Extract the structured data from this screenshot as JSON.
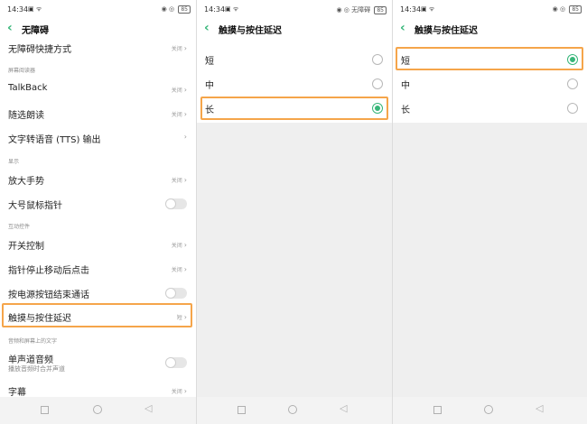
{
  "status": {
    "time": "14:34",
    "icons": "▣ ᯤ",
    "right_icons": "◉ ◎",
    "battery": "85",
    "right_label_p2": "无障碍"
  },
  "panel1": {
    "title": "无障碍",
    "rows": {
      "shortcut": {
        "label": "无障碍快捷方式",
        "value": "关闭"
      },
      "sec_screen_reader": "屏幕阅读器",
      "talkback": {
        "label": "TalkBack",
        "value": "关闭"
      },
      "select_speak": {
        "label": "随选朗读",
        "value": "关闭"
      },
      "tts": {
        "label": "文字转语音 (TTS) 输出"
      },
      "sec_display": "显示",
      "magnify": {
        "label": "放大手势",
        "value": "关闭"
      },
      "large_pointer": {
        "label": "大号鼠标指针"
      },
      "sec_interaction": "互动控件",
      "switch_access": {
        "label": "开关控制",
        "value": "关闭"
      },
      "dwell_click": {
        "label": "指针停止移动后点击",
        "value": "关闭"
      },
      "power_end_call": {
        "label": "按电源按钮结束通话"
      },
      "touch_delay": {
        "label": "触摸与按住延迟",
        "value": "短"
      },
      "sec_audio": "音频和屏幕上的文字",
      "mono_audio": {
        "label": "单声道音频",
        "sub": "播放音频时合并声道"
      },
      "captions": {
        "label": "字幕",
        "value": "关闭"
      }
    }
  },
  "panel2": {
    "title": "触摸与按住延迟",
    "options": [
      {
        "label": "短",
        "selected": false
      },
      {
        "label": "中",
        "selected": false
      },
      {
        "label": "长",
        "selected": true
      }
    ]
  },
  "panel3": {
    "title": "触摸与按住延迟",
    "options": [
      {
        "label": "短",
        "selected": true
      },
      {
        "label": "中",
        "selected": false
      },
      {
        "label": "长",
        "selected": false
      }
    ]
  },
  "colors": {
    "accent": "#37b679",
    "highlight": "#f5a54a"
  }
}
